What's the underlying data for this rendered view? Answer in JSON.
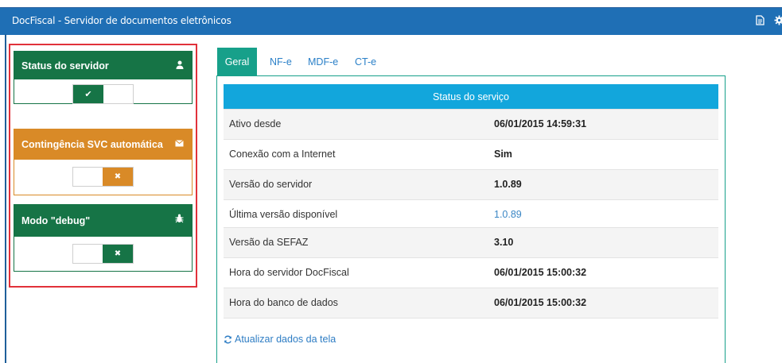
{
  "app": {
    "title": "DocFiscal - Servidor de documentos eletrônicos",
    "icons": [
      "document-icon",
      "gear-icon"
    ]
  },
  "colors": {
    "titlebar": "#1f6fb5",
    "green": "#167446",
    "orange": "#d98a27",
    "teal": "#17a08a",
    "header_blue": "#12a6dc",
    "highlight_red": "#e1313a"
  },
  "sidebar": {
    "panels": [
      {
        "label": "Status do servidor",
        "icon": "user-icon",
        "color": "green",
        "toggle_on": true,
        "toggle_symbol": "✔"
      },
      {
        "label": "Contingência SVC automática",
        "icon": "envelope-icon",
        "color": "orange",
        "toggle_on": false,
        "toggle_symbol": "✖"
      },
      {
        "label": "Modo \"debug\"",
        "icon": "bug-icon",
        "color": "green",
        "toggle_on": false,
        "toggle_symbol": "✖"
      }
    ]
  },
  "tabs": [
    {
      "label": "Geral",
      "active": true
    },
    {
      "label": "NF-e",
      "active": false
    },
    {
      "label": "MDF-e",
      "active": false
    },
    {
      "label": "CT-e",
      "active": false
    }
  ],
  "status": {
    "header": "Status do serviço",
    "rows": [
      {
        "label": "Ativo desde",
        "value": "06/01/2015 14:59:31"
      },
      {
        "label": "Conexão com a Internet",
        "value": "Sim"
      },
      {
        "label": "Versão do servidor",
        "value": "1.0.89"
      },
      {
        "label": "Última versão disponível",
        "value": "1.0.89"
      },
      {
        "label": "Versão da SEFAZ",
        "value": "3.10"
      },
      {
        "label": "Hora do servidor DocFiscal",
        "value": "06/01/2015 15:00:32"
      },
      {
        "label": "Hora do banco de dados",
        "value": "06/01/2015 15:00:32"
      }
    ]
  },
  "refresh_label": "Atualizar dados da tela"
}
